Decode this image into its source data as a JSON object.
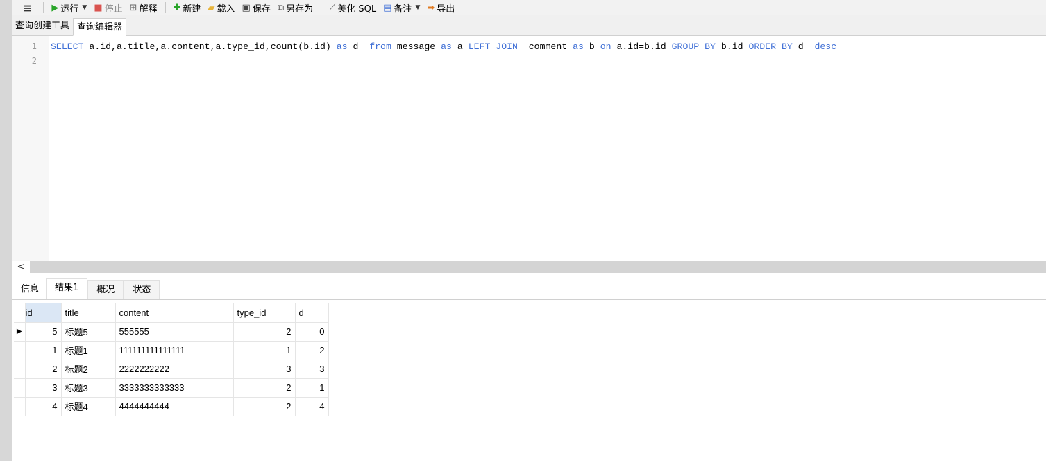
{
  "toolbar": {
    "menu_icon": "hamburger-icon",
    "run_label": "运行",
    "stop_label": "停止",
    "explain_label": "解释",
    "new_label": "新建",
    "load_label": "载入",
    "save_label": "保存",
    "save_as_label": "另存为",
    "beautify_label": "美化 SQL",
    "comment_label": "备注",
    "export_label": "导出"
  },
  "query_tabs": [
    "查询创建工具",
    "查询编辑器"
  ],
  "editor": {
    "line_numbers": [
      "1",
      "2"
    ],
    "sql": "SELECT a.id,a.title,a.content,a.type_id,count(b.id) as d  from message as a LEFT JOIN  comment as b on a.id=b.id GROUP BY b.id ORDER BY d  desc"
  },
  "result_tabs": [
    "信息",
    "结果1",
    "概况",
    "状态"
  ],
  "grid": {
    "columns": [
      "id",
      "title",
      "content",
      "type_id",
      "d"
    ],
    "rows": [
      [
        "5",
        "标题5",
        "555555",
        "2",
        "0"
      ],
      [
        "1",
        "标题1",
        "111111111111111",
        "1",
        "2"
      ],
      [
        "2",
        "标题2",
        "2222222222",
        "3",
        "3"
      ],
      [
        "3",
        "标题3",
        "3333333333333",
        "2",
        "1"
      ],
      [
        "4",
        "标题4",
        "4444444444",
        "2",
        "4"
      ]
    ]
  },
  "colors": {
    "keyword": "#3f6fd6",
    "run_green": "#2aa52a",
    "selected_header": "#dbe7f5"
  }
}
